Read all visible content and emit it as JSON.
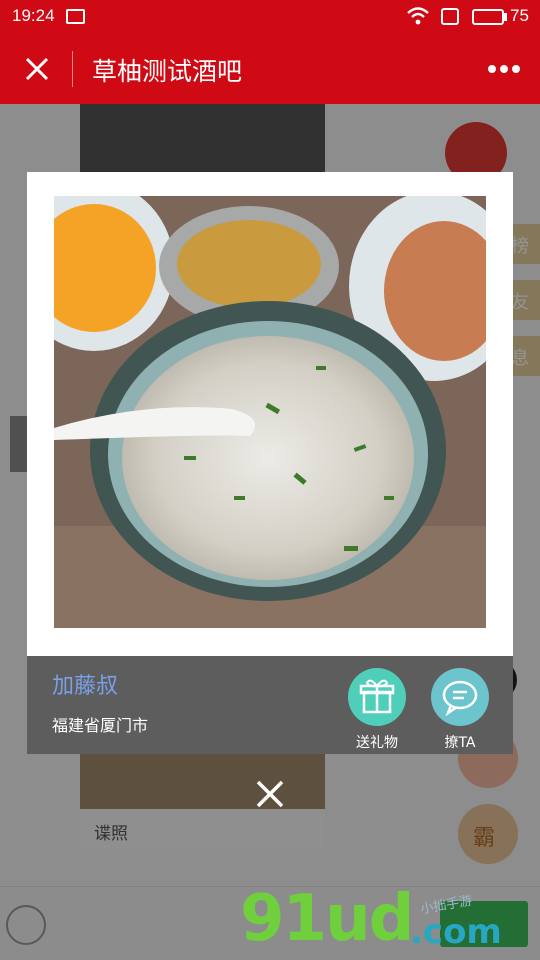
{
  "status_bar": {
    "time": "19:24",
    "battery": "75",
    "battery_level": 0.75
  },
  "header": {
    "title": "草柚测试酒吧"
  },
  "background": {
    "photo_caption": "谍照",
    "side_tabs": [
      "榜",
      "友",
      "息"
    ],
    "right_buttons": [
      "¥",
      "霸"
    ]
  },
  "modal": {
    "user_name": "加藤叔",
    "location": "福建省厦门市",
    "actions": {
      "gift_label": "送礼物",
      "chat_label": "撩TA"
    }
  },
  "watermark": {
    "brand_main": "91ud",
    "brand_domain": ".com",
    "brand_tagline": "小拙手游"
  },
  "colors": {
    "header_red": "#cf0a14",
    "name_blue": "#7aa0e8",
    "gift_teal": "#4fcfb9",
    "chat_teal": "#6cc4cc"
  }
}
